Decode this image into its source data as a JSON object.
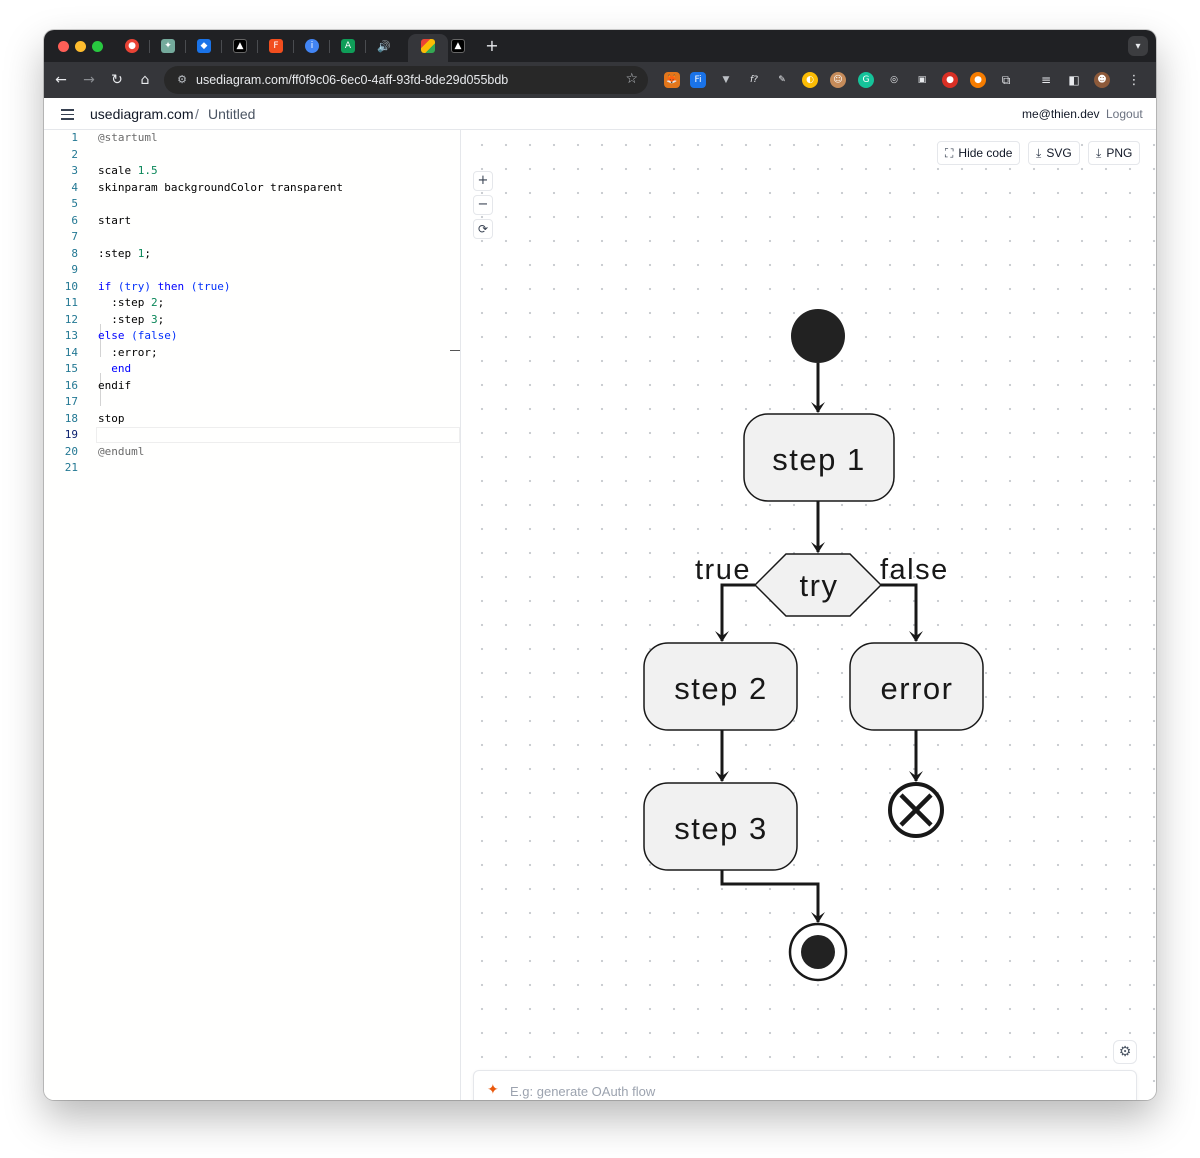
{
  "browser": {
    "tabs": [
      {
        "icon": "chrome-extension-icon",
        "color": "#e94335"
      },
      {
        "icon": "chatgpt-icon",
        "color": "#74aa9c"
      },
      {
        "icon": "shield-icon",
        "color": "#1a73e8"
      },
      {
        "icon": "vercel-icon",
        "color": "#000000"
      },
      {
        "icon": "figma-icon",
        "color": "#f24e1e"
      },
      {
        "icon": "info-icon",
        "color": "#4285f4"
      },
      {
        "icon": "app-icon",
        "color": "#0f9d58"
      },
      {
        "icon": "speaker-icon",
        "color": "#bdc1c6"
      },
      {
        "icon": "usediagram-icon",
        "color": "#ea4335"
      },
      {
        "icon": "vercel-icon",
        "color": "#000000"
      }
    ],
    "new_tab_label": "+",
    "url": "usediagram.com/ff0f9c06-6ec0-4aff-93fd-8de29d055bdb",
    "extensions": [
      "metamask-icon",
      "fi-icon",
      "vue-icon",
      "formula-icon",
      "pen-icon",
      "compass-icon",
      "avatar-icon",
      "grammarly-icon",
      "target-icon",
      "glasses-icon",
      "shield-red-icon",
      "rocket-icon",
      "puzzle-icon",
      "playlist-icon",
      "sidebar-icon",
      "profile-icon",
      "kebab-menu-icon"
    ]
  },
  "header": {
    "site": "usediagram.com",
    "separator": "/",
    "title": "Untitled",
    "user_email": "me@thien.dev",
    "logout_label": "Logout"
  },
  "editor": {
    "line_numbers": [
      "1",
      "2",
      "3",
      "4",
      "5",
      "6",
      "7",
      "8",
      "9",
      "10",
      "11",
      "12",
      "13",
      "14",
      "15",
      "16",
      "17",
      "18",
      "19",
      "20",
      "21"
    ],
    "active_line": "19"
  },
  "toolbar": {
    "hide_code_label": "Hide code",
    "svg_label": "SVG",
    "png_label": "PNG",
    "zoom_in": "+",
    "zoom_out": "−",
    "reset": "⟳"
  },
  "diagram": {
    "step1": "step 1",
    "decision": "try",
    "true_label": "true",
    "false_label": "false",
    "step2": "step 2",
    "step3": "step 3",
    "error": "error"
  },
  "prompt": {
    "placeholder": "E.g: generate OAuth flow"
  }
}
